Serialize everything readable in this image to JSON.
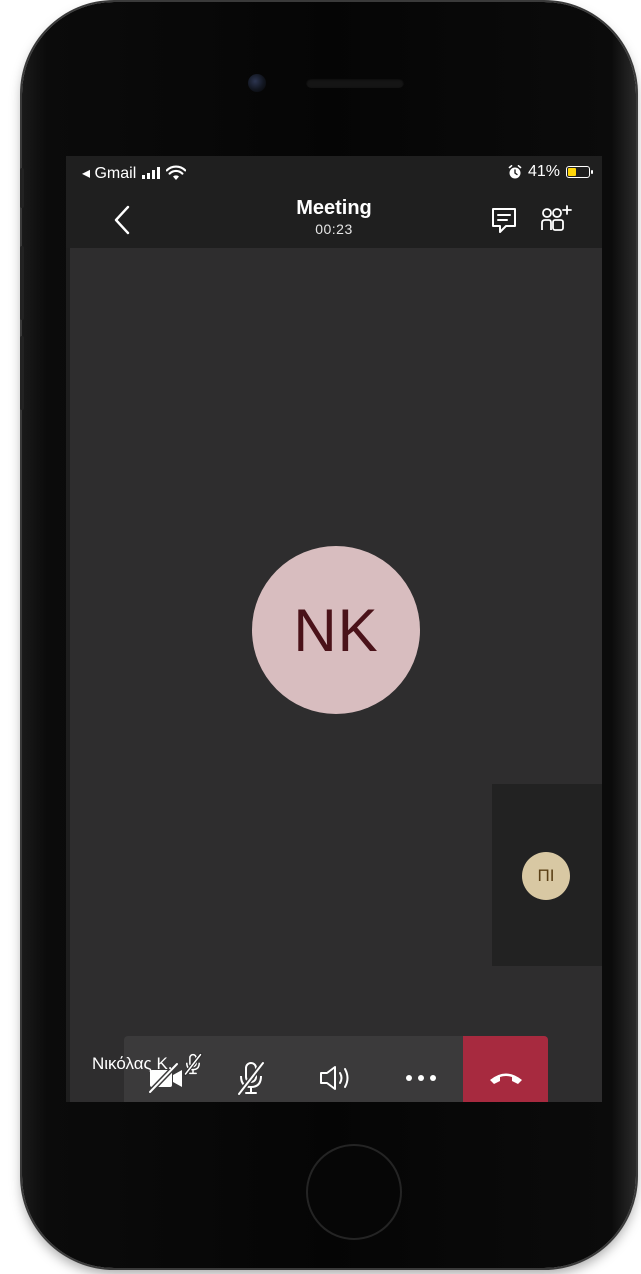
{
  "status_bar": {
    "back_app": "◂ Gmail",
    "battery_percent": "41%",
    "battery_level": 0.41,
    "alarm_icon": "alarm-clock-icon",
    "wifi_icon": "wifi-icon",
    "signal_icon": "cellular-signal-icon"
  },
  "header": {
    "title": "Meeting",
    "timer": "00:23",
    "back_icon": "chevron-left-icon",
    "chat_icon": "chat-icon",
    "add_people_icon": "add-people-icon"
  },
  "main_participant": {
    "initials": "NK",
    "avatar_color": "#d8bdbf",
    "initials_color": "#4a1219"
  },
  "secondary_participant": {
    "initials": "ΠΙ",
    "avatar_color": "#d8c8a3"
  },
  "controls": [
    {
      "name": "camera-off-button",
      "icon": "video-off-icon"
    },
    {
      "name": "mute-button",
      "icon": "microphone-off-icon"
    },
    {
      "name": "speaker-button",
      "icon": "speaker-icon"
    },
    {
      "name": "more-options-button",
      "icon": "more-horizontal-icon"
    },
    {
      "name": "hang-up-button",
      "icon": "phone-hangup-icon",
      "color": "#a72a3f"
    }
  ],
  "participant_label": {
    "name": "Νικόλας Κ.",
    "status_icon": "microphone-off-icon"
  }
}
